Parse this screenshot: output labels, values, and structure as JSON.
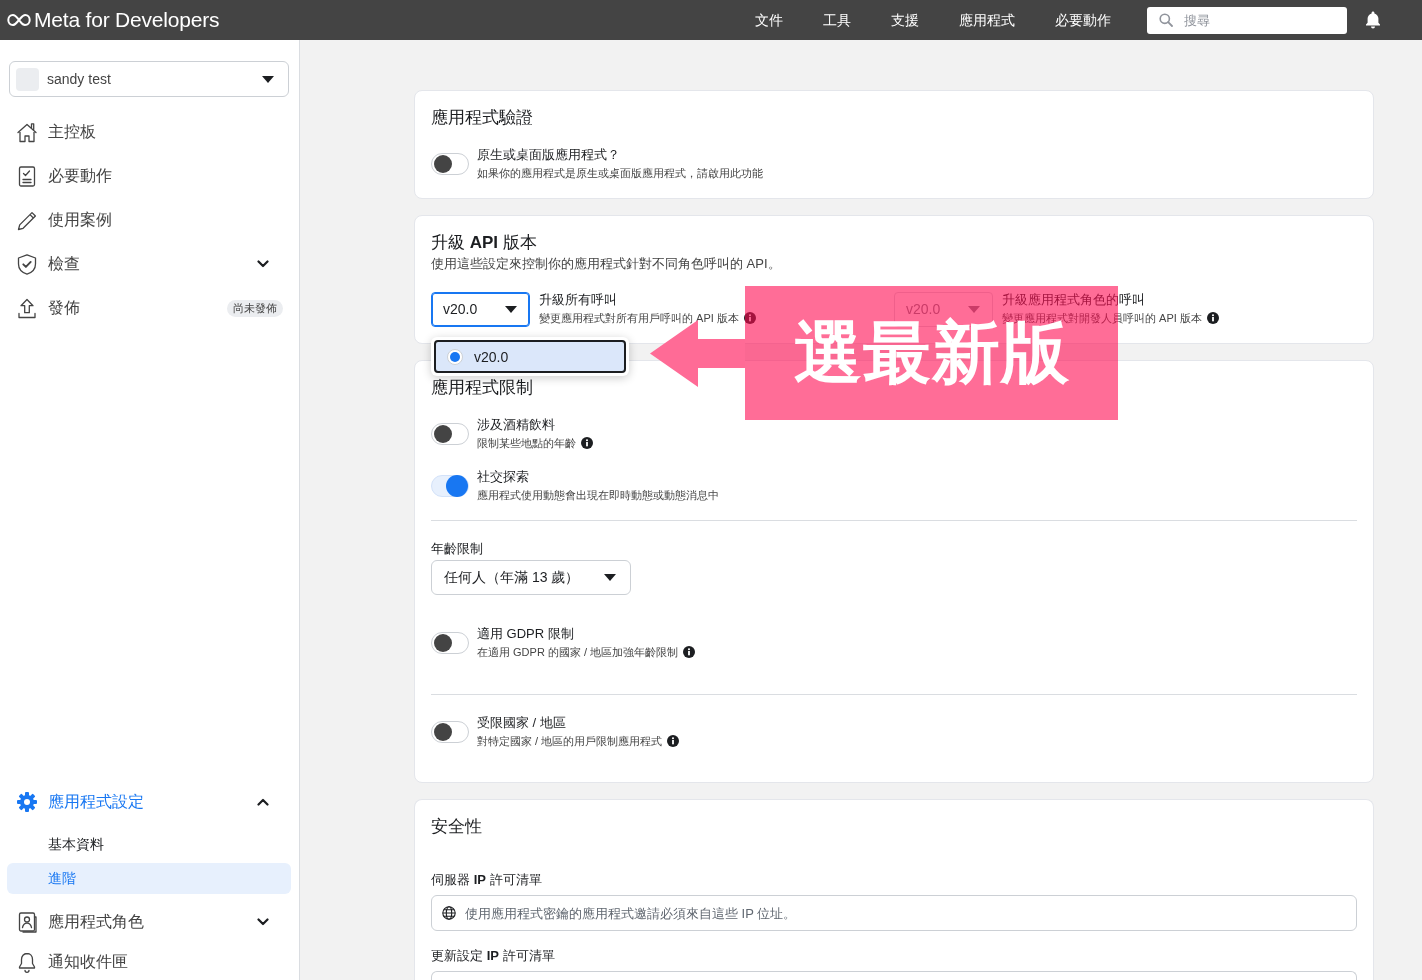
{
  "top_bar": {
    "brand": "Meta for Developers",
    "nav": [
      "文件",
      "工具",
      "支援",
      "應用程式",
      "必要動作"
    ],
    "search": {
      "placeholder": "搜尋"
    }
  },
  "sidebar": {
    "app_selector": {
      "value": "sandy test"
    },
    "items": [
      {
        "label": "主控板",
        "selected": false
      },
      {
        "label": "必要動作",
        "selected": false
      },
      {
        "label": "使用案例",
        "selected": false
      },
      {
        "label": "檢查",
        "selected": false,
        "expanded": false
      },
      {
        "label": "發佈",
        "selected": false,
        "badge": "尚未發佈"
      }
    ],
    "lower_items": [
      {
        "label": "應用程式設定",
        "selected": true,
        "expanded": true,
        "children": [
          {
            "label": "基本資料",
            "selected": false
          },
          {
            "label": "進階",
            "selected": true
          }
        ]
      },
      {
        "label": "應用程式角色",
        "selected": false,
        "expanded": false
      },
      {
        "label": "通知收件匣",
        "selected": false
      }
    ]
  },
  "app_verification": {
    "title": "應用程式驗證",
    "toggles": [
      {
        "label": "原生或桌面版應用程式？",
        "description": "如果你的應用程式是原生或桌面版應用程式，請啟用此功能",
        "info": false,
        "on": false
      }
    ]
  },
  "api_version": {
    "title": "升級 **API** 版本",
    "description": "使用這些設定來控制你的應用程式針對不同角色呼叫的 API。",
    "selectors": [
      {
        "value": "v20.0",
        "label": "升級所有呼叫",
        "description": "變更應用程式對所有用戶呼叫的 API 版本",
        "info": true,
        "open": true,
        "disabled": false,
        "options": [
          {
            "label": "v20.0",
            "selected": true
          }
        ]
      },
      {
        "value": "v20.0",
        "label": "升級應用程式角色的呼叫",
        "description": "變更應用程式對開發人員呼叫的 API 版本",
        "info": true,
        "open": false,
        "disabled": true
      }
    ]
  },
  "app_restrictions": {
    "title": "應用程式限制",
    "sections": [
      {
        "items": [
          {
            "kind": "toggle",
            "label": "涉及酒精飲料",
            "description": "限制某些地點的年齡",
            "info": true,
            "on": false
          },
          {
            "kind": "toggle",
            "label": "社交探索",
            "description": "應用程式使用動態會出現在即時動態或動態消息中",
            "info": false,
            "on": true
          }
        ]
      },
      {
        "items": [
          {
            "kind": "select",
            "label": "年齡限制",
            "value": "任何人（年滿 13 歲）"
          },
          {
            "kind": "toggle",
            "label": "適用 GDPR 限制",
            "description": "在適用 GDPR 的國家 / 地區加強年齡限制",
            "info": true,
            "on": false
          }
        ]
      },
      {
        "items": [
          {
            "kind": "toggle",
            "label": "受限國家 / 地區",
            "description": "對特定國家 / 地區的用戶限制應用程式",
            "info": true,
            "on": false
          }
        ]
      }
    ]
  },
  "security": {
    "title": "安全性",
    "fields": [
      {
        "label": "伺服器 **IP** 許可清單",
        "placeholder": "使用應用程式密鑰的應用程式邀請必須來自這些 IP 位址。"
      },
      {
        "label": "更新設定 **IP** 許可清單"
      }
    ]
  },
  "callout": {
    "text": "選最新版"
  }
}
